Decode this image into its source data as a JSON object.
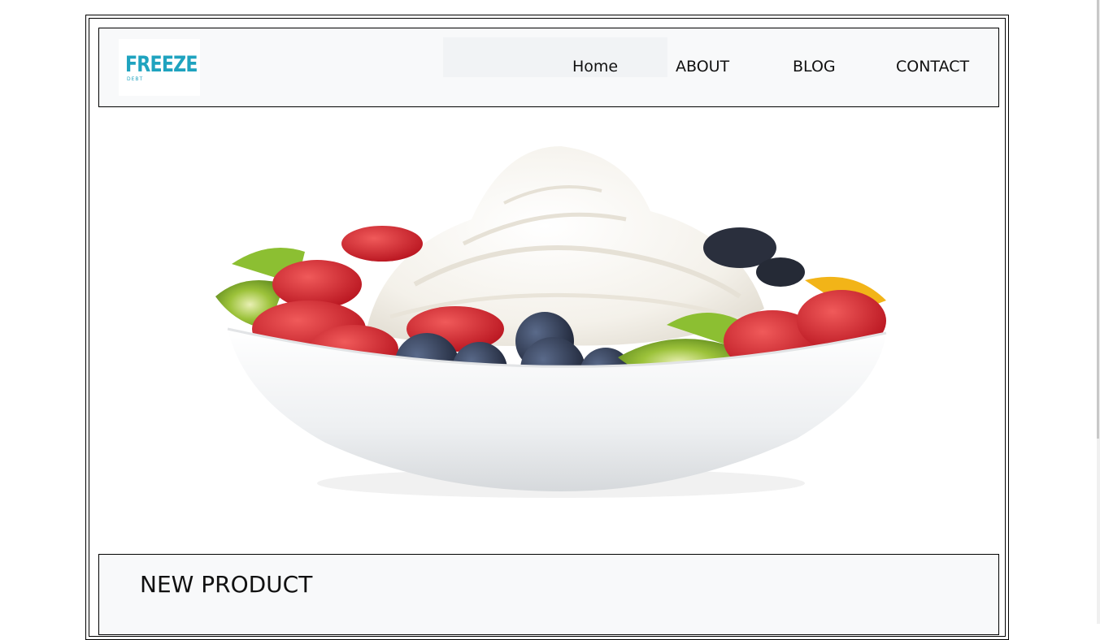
{
  "header": {
    "logo": {
      "text": "FREEZE",
      "subtext": "DEBT",
      "color": "#1fa3bf"
    },
    "nav": [
      {
        "label": "Home"
      },
      {
        "label": "ABOUT"
      },
      {
        "label": "BLOG"
      },
      {
        "label": "CONTACT"
      }
    ]
  },
  "hero": {
    "image": "frozen-yogurt-fruit-bowl"
  },
  "section": {
    "title": "NEW PRODUCT"
  },
  "colors": {
    "navbar_bg": "#f8f9fa",
    "border": "#000000",
    "logo_accent": "#1fa3bf"
  }
}
